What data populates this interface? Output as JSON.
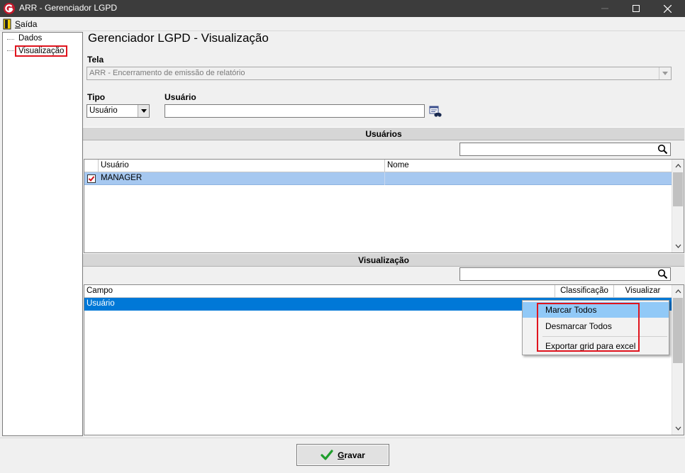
{
  "window": {
    "title": "ARR - Gerenciador LGPD",
    "controls": {
      "minimize": "minimize-icon",
      "maximize": "maximize-icon",
      "close": "close-icon"
    }
  },
  "menu": {
    "exit_icon": "exit-door-icon",
    "saida_first": "S",
    "saida_rest": "aída"
  },
  "tree": {
    "items": [
      {
        "label": "Dados"
      },
      {
        "label": "Visualização",
        "selected": true
      }
    ]
  },
  "page": {
    "title": "Gerenciador LGPD - Visualização"
  },
  "form": {
    "tela_label": "Tela",
    "tela_value": "ARR - Encerramento de emissão de relatório",
    "tipo_label": "Tipo",
    "tipo_value": "Usuário",
    "usuario_label": "Usuário",
    "usuario_value": ""
  },
  "usuarios_section": {
    "title": "Usuários",
    "search_value": "",
    "columns": [
      "Usuário",
      "Nome"
    ],
    "rows": [
      {
        "checked": true,
        "usuario": "MANAGER",
        "nome": ""
      }
    ]
  },
  "visualizacao_section": {
    "title": "Visualização",
    "search_value": "",
    "columns": [
      "Campo",
      "Classificação",
      "Visualizar"
    ],
    "rows": [
      {
        "campo": "Usuário",
        "classificacao": "",
        "visualizar": ""
      }
    ]
  },
  "context_menu": {
    "items": [
      "Marcar Todos",
      "Desmarcar Todos",
      "Exportar grid para excel"
    ],
    "hovered": "Marcar Todos"
  },
  "footer": {
    "gravar_first": "G",
    "gravar_rest": "ravar"
  },
  "colors": {
    "titlebar": "#3c3c3c",
    "selection_blue": "#0078d7",
    "row_highlight": "#a6c8f0",
    "menu_hover": "#91c9f7",
    "annotation_red": "#e0141e"
  }
}
